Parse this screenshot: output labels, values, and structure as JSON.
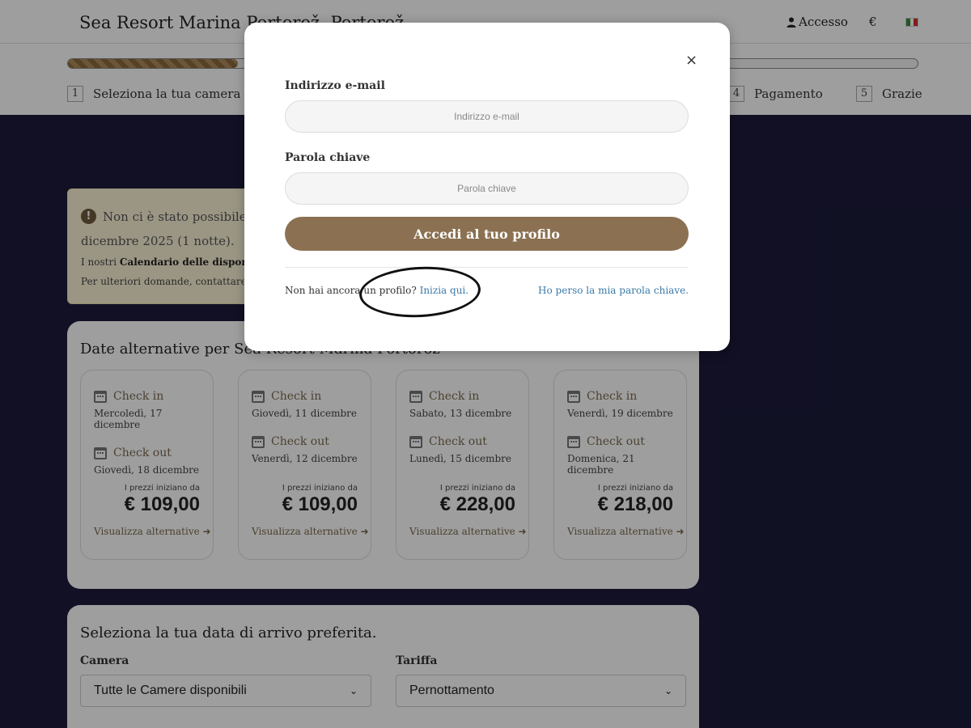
{
  "header": {
    "hotel_name": "Sea Resort Marina Portorož, Portorož",
    "login_label": "Accesso",
    "currency": "€",
    "flag_colors": [
      "#3a8a3a",
      "#ffffff",
      "#d32f2f"
    ],
    "progress_fraction": 0.2
  },
  "steps": [
    {
      "num": "1",
      "label": "Seleziona la tua camera"
    },
    {
      "num": "4",
      "label": "Pagamento"
    },
    {
      "num": "5",
      "label": "Grazie"
    }
  ],
  "alert": {
    "line1": "Non ci è stato possibile tro",
    "line2": "dicembre 2025 (1 notte).",
    "small1_prefix": "I nostri ",
    "small1_bold": "Calendario delle disponibilità",
    "small2": "Per ulteriori domande, contattare l'hot"
  },
  "alternatives": {
    "title": "Date alternative per Sea Resort Marina Portoroz",
    "checkin_label": "Check in",
    "checkout_label": "Check out",
    "price_from_label": "I prezzi iniziano da",
    "view_label": "Visualizza alternative",
    "cards": [
      {
        "checkin": "Mercoledì, 17 dicembre",
        "checkout": "Giovedì, 18 dicembre",
        "price": "€ 109,00"
      },
      {
        "checkin": "Giovedì, 11 dicembre",
        "checkout": "Venerdì, 12 dicembre",
        "price": "€ 109,00"
      },
      {
        "checkin": "Sabato, 13 dicembre",
        "checkout": "Lunedì, 15 dicembre",
        "price": "€ 228,00"
      },
      {
        "checkin": "Venerdì, 19 dicembre",
        "checkout": "Domenica, 21 dicembre",
        "price": "€ 218,00"
      }
    ]
  },
  "select_panel": {
    "title": "Seleziona la tua data di arrivo preferita.",
    "room_label": "Camera",
    "room_value": "Tutte le Camere disponibili",
    "rate_label": "Tariffa",
    "rate_value": "Pernottamento"
  },
  "modal": {
    "email_label": "Indirizzo e-mail",
    "email_placeholder": "Indirizzo e-mail",
    "password_label": "Parola chiave",
    "password_placeholder": "Parola chiave",
    "submit_label": "Accedi al tuo profilo",
    "no_profile_text": "Non hai ancora un profilo?",
    "signup_link": "Inizia qui.",
    "forgot_link": "Ho perso la mia parola chiave.",
    "close_symbol": "×"
  }
}
